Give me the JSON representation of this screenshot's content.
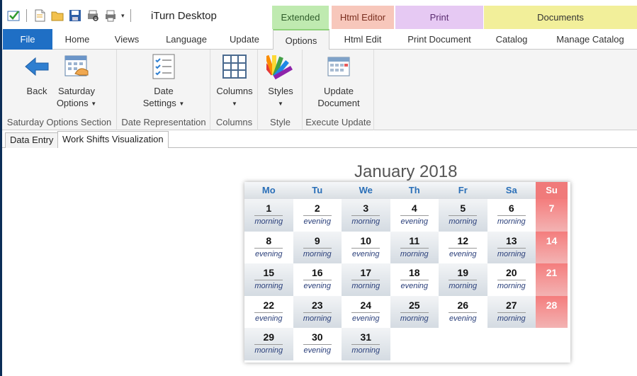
{
  "titlebar": {
    "title": "iTurn Desktop"
  },
  "context_groups": {
    "extended": "Extended",
    "html_editor": "Html Editor",
    "print": "Print",
    "documents": "Documents"
  },
  "tabs": {
    "file": "File",
    "home": "Home",
    "views": "Views",
    "language": "Language",
    "update": "Update",
    "options": "Options",
    "html_edit": "Html Edit",
    "print_document": "Print Document",
    "catalog": "Catalog",
    "manage_catalog": "Manage Catalog"
  },
  "ribbon": {
    "back": "Back",
    "saturday_options_1": "Saturday",
    "saturday_options_2": "Options",
    "group_saturday": "Saturday Options Section",
    "date_settings_1": "Date",
    "date_settings_2": "Settings",
    "group_date": "Date Representation",
    "columns": "Columns",
    "group_columns": "Columns",
    "styles": "Styles",
    "group_style": "Style",
    "update_doc_1": "Update",
    "update_doc_2": "Document",
    "group_update": "Execute Update"
  },
  "doc_tabs": {
    "data_entry": "Data Entry",
    "work_shifts": "Work Shifts Visualization"
  },
  "calendar": {
    "title": "January 2018",
    "days": [
      "Mo",
      "Tu",
      "We",
      "Th",
      "Fr",
      "Sa",
      "Su"
    ],
    "weeks": [
      [
        {
          "d": "1",
          "s": "morning"
        },
        {
          "d": "2",
          "s": "evening"
        },
        {
          "d": "3",
          "s": "morning"
        },
        {
          "d": "4",
          "s": "evening"
        },
        {
          "d": "5",
          "s": "morning"
        },
        {
          "d": "6",
          "s": "morning"
        },
        {
          "d": "7",
          "s": ""
        }
      ],
      [
        {
          "d": "8",
          "s": "evening"
        },
        {
          "d": "9",
          "s": "morning"
        },
        {
          "d": "10",
          "s": "evening"
        },
        {
          "d": "11",
          "s": "morning"
        },
        {
          "d": "12",
          "s": "evening"
        },
        {
          "d": "13",
          "s": "morning"
        },
        {
          "d": "14",
          "s": ""
        }
      ],
      [
        {
          "d": "15",
          "s": "morning"
        },
        {
          "d": "16",
          "s": "evening"
        },
        {
          "d": "17",
          "s": "morning"
        },
        {
          "d": "18",
          "s": "evening"
        },
        {
          "d": "19",
          "s": "morning"
        },
        {
          "d": "20",
          "s": "morning"
        },
        {
          "d": "21",
          "s": ""
        }
      ],
      [
        {
          "d": "22",
          "s": "evening"
        },
        {
          "d": "23",
          "s": "morning"
        },
        {
          "d": "24",
          "s": "evening"
        },
        {
          "d": "25",
          "s": "morning"
        },
        {
          "d": "26",
          "s": "evening"
        },
        {
          "d": "27",
          "s": "morning"
        },
        {
          "d": "28",
          "s": ""
        }
      ],
      [
        {
          "d": "29",
          "s": "morning"
        },
        {
          "d": "30",
          "s": "evening"
        },
        {
          "d": "31",
          "s": "morning"
        }
      ]
    ]
  }
}
